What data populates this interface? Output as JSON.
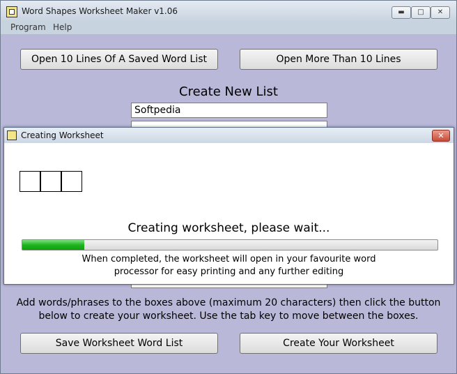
{
  "window": {
    "title": "Word Shapes Worksheet Maker v1.06",
    "minimize_glyph": "▬",
    "maximize_glyph": "□",
    "close_glyph": "✕"
  },
  "menu": {
    "items": [
      "Program",
      "Help"
    ]
  },
  "buttons": {
    "open_10": "Open 10 Lines Of A Saved Word List",
    "open_more": "Open More Than 10 Lines",
    "save_list": "Save Worksheet Word List",
    "create_worksheet": "Create Your Worksheet"
  },
  "create_list": {
    "heading": "Create New List",
    "words": [
      "Softpedia",
      "",
      ""
    ]
  },
  "instructions": {
    "line1": "Add words/phrases to the boxes above (maximum 20 characters) then click the button",
    "line2": "below to create your worksheet. Use the tab key to move between the boxes."
  },
  "dialog": {
    "title": "Creating Worksheet",
    "close_glyph": "✕",
    "status": "Creating worksheet, please wait...",
    "info_line1": "When completed, the worksheet will open in your favourite word",
    "info_line2": "processor for easy printing and any further editing",
    "progress_percent": 15
  },
  "colors": {
    "background": "#b9b8d9",
    "progress_green": "#1fb51f"
  }
}
